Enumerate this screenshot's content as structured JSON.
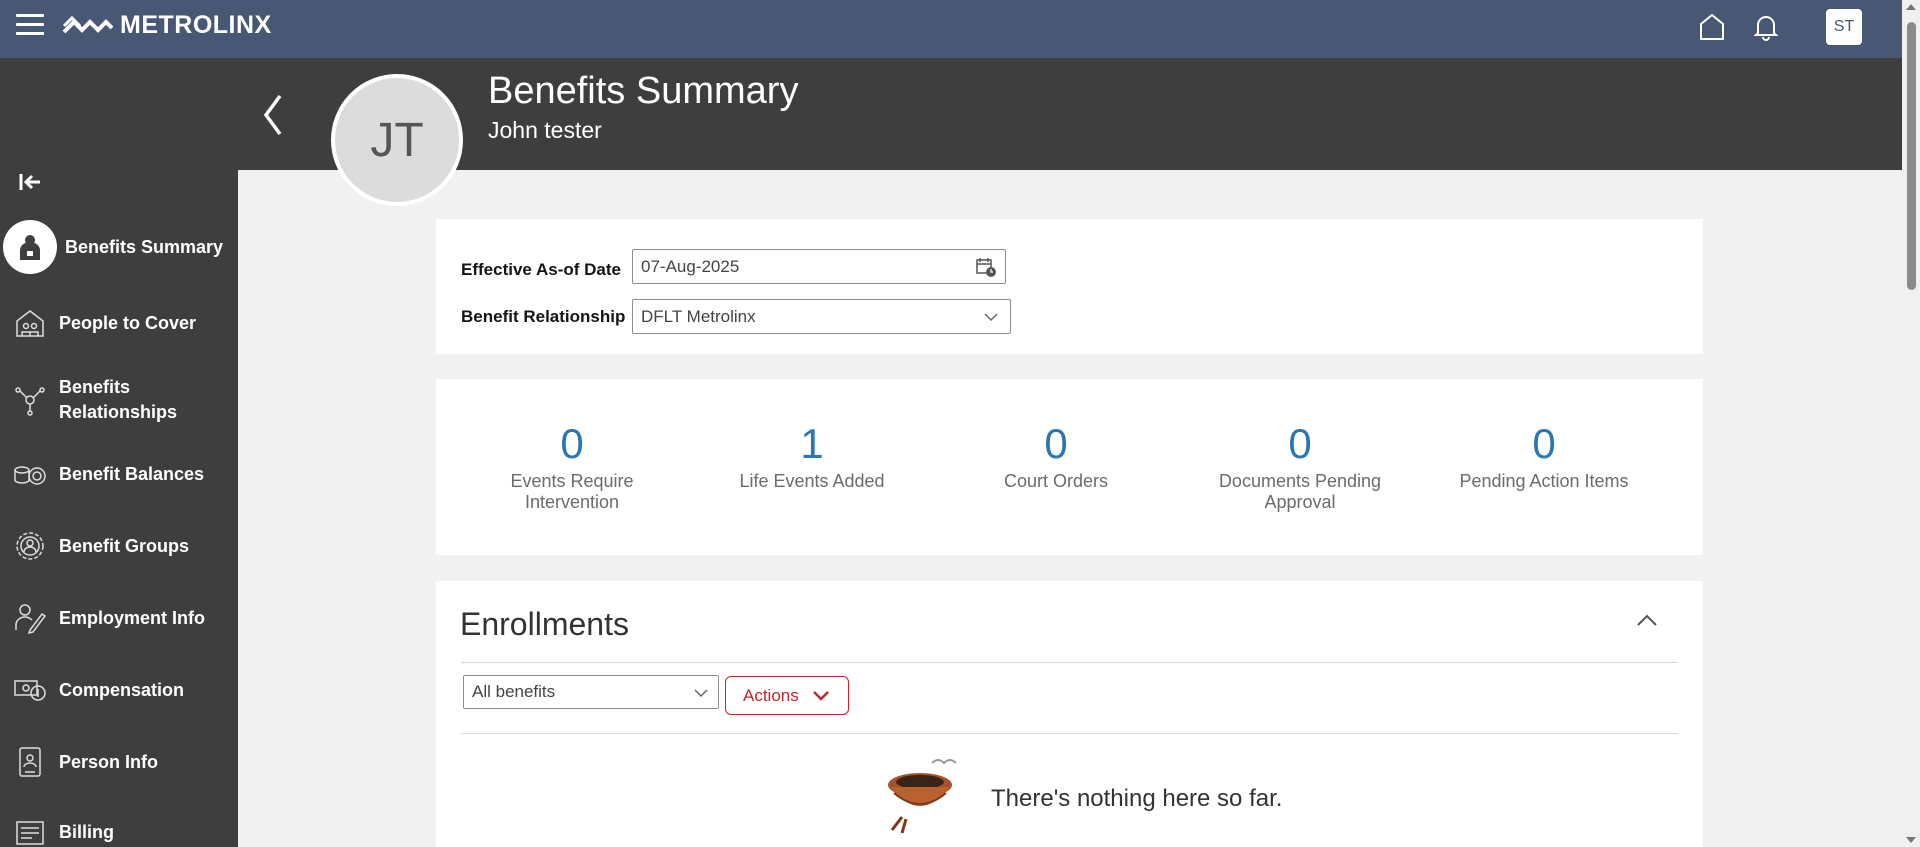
{
  "topbar": {
    "brand": "METROLINX",
    "user_initials": "ST",
    "icons": [
      "menu-icon",
      "home-icon",
      "bell-icon"
    ]
  },
  "header": {
    "title": "Benefits Summary",
    "subtitle": "John tester",
    "avatar_initials": "JT"
  },
  "sidebar": {
    "items": [
      {
        "label": "Benefits Summary",
        "icon": "person-badge-icon",
        "active": true
      },
      {
        "label": "People to Cover",
        "icon": "house-people-icon"
      },
      {
        "label": "Benefits Relationships",
        "icon": "network-icon"
      },
      {
        "label": "Benefit Balances",
        "icon": "coins-target-icon"
      },
      {
        "label": "Benefit Groups",
        "icon": "gear-person-icon"
      },
      {
        "label": "Employment Info",
        "icon": "person-pen-icon"
      },
      {
        "label": "Compensation",
        "icon": "money-icon"
      },
      {
        "label": "Person Info",
        "icon": "id-card-icon"
      },
      {
        "label": "Billing",
        "icon": "bill-icon"
      }
    ]
  },
  "filters": {
    "effective_date_label": "Effective As-of Date",
    "effective_date_value": "07-Aug-2025",
    "relationship_label": "Benefit Relationship",
    "relationship_value": "DFLT Metrolinx"
  },
  "stats": [
    {
      "value": "0",
      "label": "Events Require Intervention"
    },
    {
      "value": "1",
      "label": "Life Events Added"
    },
    {
      "value": "0",
      "label": "Court Orders"
    },
    {
      "value": "0",
      "label": "Documents Pending Approval"
    },
    {
      "value": "0",
      "label": "Pending Action Items"
    }
  ],
  "enrollments": {
    "title": "Enrollments",
    "filter_value": "All benefits",
    "actions_label": "Actions",
    "empty_message": "There's nothing here so far."
  },
  "colors": {
    "topbar": "#485874",
    "dark": "#3e3e3e",
    "accent_blue": "#2b77b3",
    "action_red": "#c0262d"
  }
}
